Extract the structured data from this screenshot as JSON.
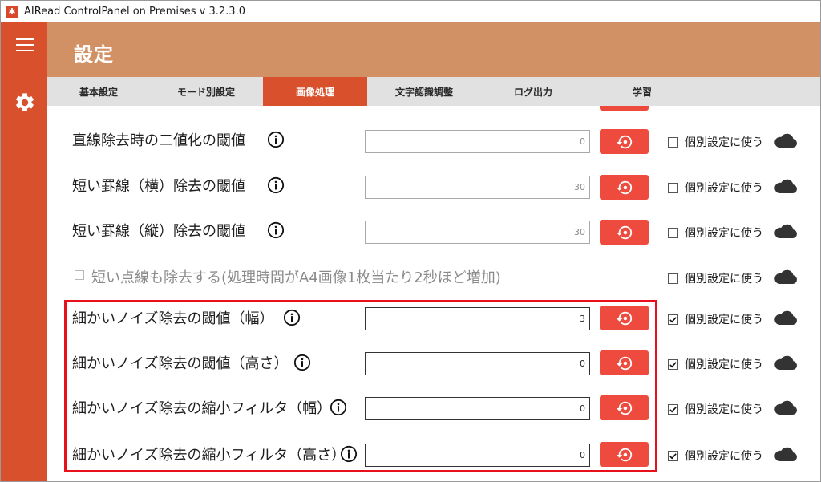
{
  "app": {
    "title": "AIRead ControlPanel on Premises v 3.2.3.0"
  },
  "sidebar": {
    "menu_icon": "hamburger-menu-icon",
    "settings_icon": "gear-icon"
  },
  "header": {
    "title": "設定"
  },
  "tabs": [
    {
      "label": "基本設定",
      "active": false
    },
    {
      "label": "モード別設定",
      "active": false
    },
    {
      "label": "画像処理",
      "active": true
    },
    {
      "label": "文字認識調整",
      "active": false
    },
    {
      "label": "ログ出力",
      "active": false
    },
    {
      "label": "学習",
      "active": false
    }
  ],
  "common": {
    "individual_label": "個別設定に使う"
  },
  "settings": [
    {
      "label": "直線除去時の二値化の閾値",
      "value": "0",
      "individual": false
    },
    {
      "label": "短い罫線（横）除去の閾値",
      "value": "30",
      "individual": false
    },
    {
      "label": "短い罫線（縦）除去の閾値",
      "value": "30",
      "individual": false
    },
    {
      "label": "短い点線も除去する(処理時間がA4画像1枚当たり2秒ほど増加)",
      "disabled": true,
      "individual": false
    },
    {
      "label": "細かいノイズ除去の閾値（幅）",
      "value": "3",
      "individual": true
    },
    {
      "label": "細かいノイズ除去の閾値（高さ）",
      "value": "0",
      "individual": true
    },
    {
      "label": "細かいノイズ除去の縮小フィルタ（幅）",
      "value": "0",
      "individual": true
    },
    {
      "label": "細かいノイズ除去の縮小フィルタ（高さ）",
      "value": "0",
      "individual": true
    }
  ],
  "colors": {
    "accent": "#d9512c",
    "header": "#d29164",
    "reset_button": "#ee4a3d",
    "highlight": "#e8101a"
  }
}
